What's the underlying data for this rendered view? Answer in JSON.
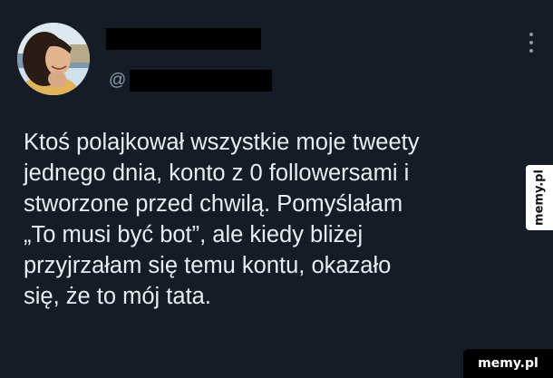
{
  "tweet": {
    "handle_prefix": "@",
    "avatar_icon": "user-avatar-photo",
    "more_icon": "vertical-dots-icon",
    "text_lines": [
      "Ktoś polajkował wszystkie moje tweety",
      "jednego dnia, konto z 0 followersami i",
      "stworzone przed chwilą. Pomyślałam",
      "„To musi być bot”, ale kiedy bliżej",
      "przyjrzałam się temu kontu, okazało",
      "się, że to mój tata."
    ]
  },
  "watermarks": {
    "side": "memy.pl",
    "corner": "memy.pl"
  },
  "colors": {
    "background": "#151c25",
    "text": "#e9edf0",
    "secondary_text": "#8899a6",
    "redaction": "#000000"
  }
}
